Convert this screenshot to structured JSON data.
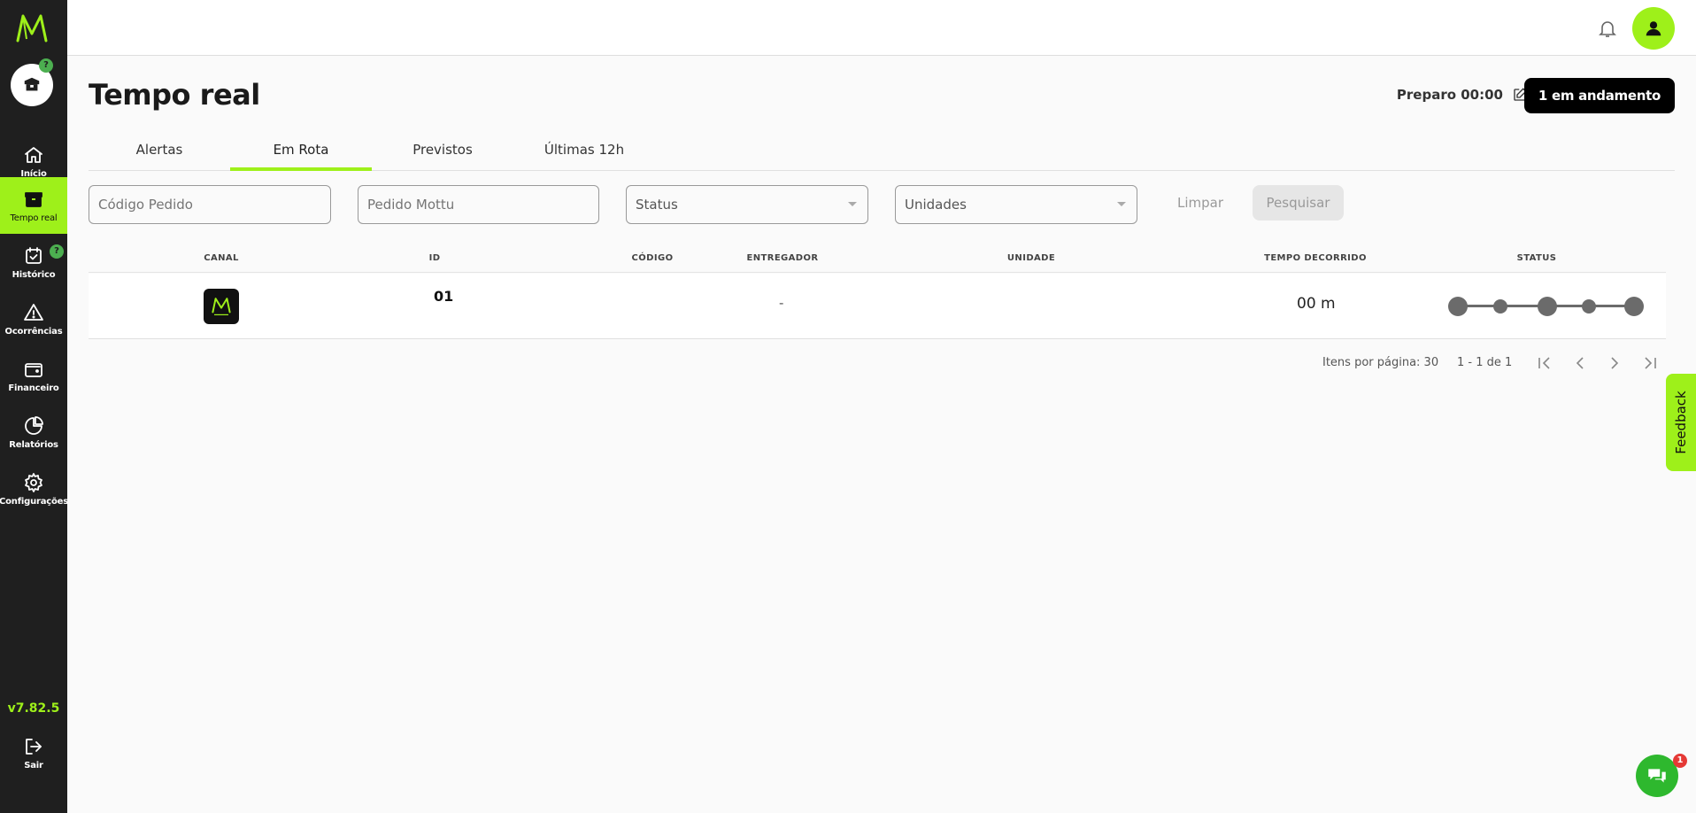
{
  "sidebar": {
    "store_badge": "?",
    "items": [
      {
        "label": "Início",
        "icon": "home-icon"
      },
      {
        "label": "Tempo real",
        "icon": "box-icon"
      },
      {
        "label": "Histórico",
        "icon": "calendar-check-icon",
        "badge": "?"
      },
      {
        "label": "Ocorrências",
        "icon": "warning-icon"
      },
      {
        "label": "Financeiro",
        "icon": "wallet-icon"
      },
      {
        "label": "Relatórios",
        "icon": "pie-chart-icon"
      },
      {
        "label": "Configurações",
        "icon": "gear-icon"
      }
    ],
    "version": "v7.82.5",
    "logout_label": "Sair"
  },
  "header": {
    "title": "Tempo real",
    "preparo": "Preparo 00:00",
    "em_andamento": "1 em andamento"
  },
  "tabs": [
    "Alertas",
    "Em Rota",
    "Previstos",
    "Últimas 12h"
  ],
  "active_tab": "Em Rota",
  "filters": {
    "codigo_pedido_placeholder": "Código Pedido",
    "pedido_mottu_placeholder": "Pedido Mottu",
    "status_placeholder": "Status",
    "unidades_placeholder": "Unidades",
    "limpar": "Limpar",
    "pesquisar": "Pesquisar"
  },
  "table": {
    "columns": [
      "CANAL",
      "ID",
      "CÓDIGO",
      "ENTREGADOR",
      "UNIDADE",
      "TEMPO DECORRIDO",
      "STATUS"
    ],
    "rows": [
      {
        "canal": "mottu-entregas-logo",
        "id": "01",
        "codigo": "",
        "entregador": "-",
        "unidade": "",
        "tempo": "00 m",
        "status_steps": 5
      }
    ]
  },
  "pagination": {
    "items_per_page": "Itens por página: 30",
    "range": "1 - 1 de 1"
  },
  "feedback_label": "Feedback",
  "chat_badge": "1",
  "colors": {
    "accent": "#9ef01a",
    "sidebar_bg": "#1f1f1f",
    "badge_green": "#4caf50",
    "chat_green": "#2eb82e",
    "notification_red": "#e53935"
  }
}
